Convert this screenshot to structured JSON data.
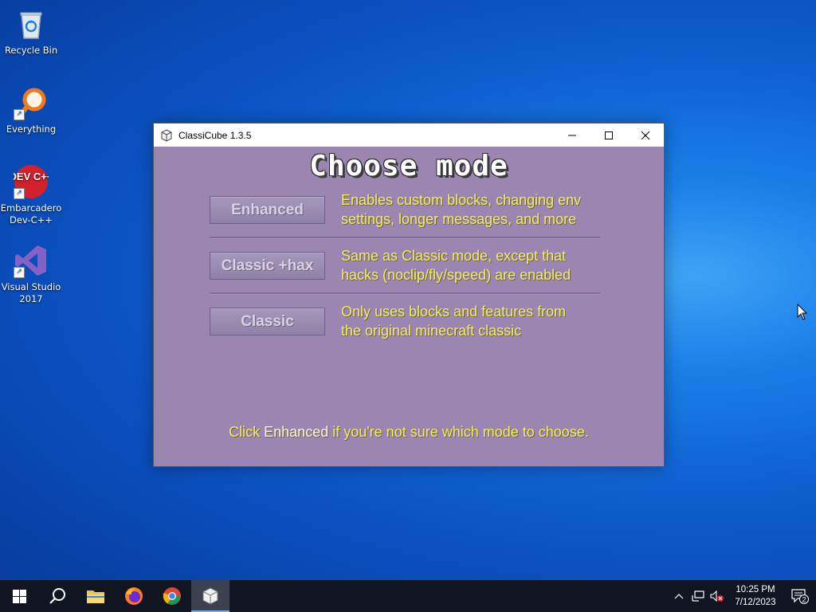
{
  "desktop": {
    "icons": [
      {
        "label": "Recycle Bin"
      },
      {
        "label": "Everything"
      },
      {
        "label": "Embarcadero Dev-C++",
        "logo_text": "DEV C++"
      },
      {
        "label": "Visual Studio 2017"
      }
    ]
  },
  "window": {
    "title": "ClassiCube 1.3.5",
    "heading": "Choose mode",
    "modes": [
      {
        "button": "Enhanced",
        "desc_line1": "Enables custom blocks, changing env",
        "desc_line2": "settings, longer messages, and more"
      },
      {
        "button": "Classic +hax",
        "desc_line1": "Same as Classic mode, except that",
        "desc_line2": "hacks (noclip/fly/speed) are enabled"
      },
      {
        "button": "Classic",
        "desc_line1": "Only uses blocks and features from",
        "desc_line2": "the original minecraft classic"
      }
    ],
    "hint": {
      "pre": "Click ",
      "highlight": "Enhanced",
      "post": " if you're not sure which mode to choose."
    }
  },
  "taskbar": {
    "items": [
      "start",
      "search",
      "file-explorer",
      "firefox",
      "chrome",
      "classicube"
    ],
    "clock_time": "10:25 PM",
    "clock_date": "7/12/2023",
    "notification_count": "2"
  },
  "colors": {
    "window_bg": "#9a86b0",
    "desc_text": "#f4ec59",
    "taskbar": "#101521"
  }
}
